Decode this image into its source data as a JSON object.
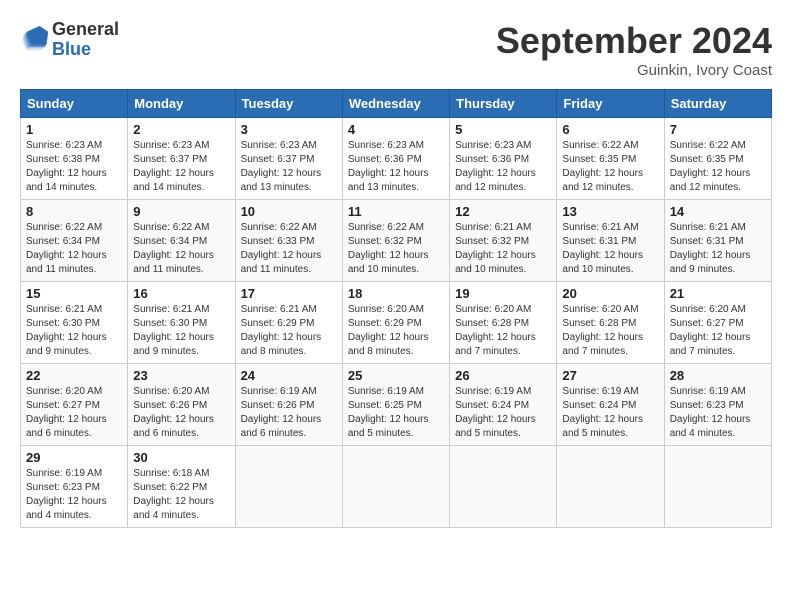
{
  "header": {
    "logo_general": "General",
    "logo_blue": "Blue",
    "month_title": "September 2024",
    "location": "Guinkin, Ivory Coast"
  },
  "days_of_week": [
    "Sunday",
    "Monday",
    "Tuesday",
    "Wednesday",
    "Thursday",
    "Friday",
    "Saturday"
  ],
  "weeks": [
    [
      {
        "num": "1",
        "sunrise": "6:23 AM",
        "sunset": "6:38 PM",
        "daylight": "12 hours and 14 minutes."
      },
      {
        "num": "2",
        "sunrise": "6:23 AM",
        "sunset": "6:37 PM",
        "daylight": "12 hours and 14 minutes."
      },
      {
        "num": "3",
        "sunrise": "6:23 AM",
        "sunset": "6:37 PM",
        "daylight": "12 hours and 13 minutes."
      },
      {
        "num": "4",
        "sunrise": "6:23 AM",
        "sunset": "6:36 PM",
        "daylight": "12 hours and 13 minutes."
      },
      {
        "num": "5",
        "sunrise": "6:23 AM",
        "sunset": "6:36 PM",
        "daylight": "12 hours and 12 minutes."
      },
      {
        "num": "6",
        "sunrise": "6:22 AM",
        "sunset": "6:35 PM",
        "daylight": "12 hours and 12 minutes."
      },
      {
        "num": "7",
        "sunrise": "6:22 AM",
        "sunset": "6:35 PM",
        "daylight": "12 hours and 12 minutes."
      }
    ],
    [
      {
        "num": "8",
        "sunrise": "6:22 AM",
        "sunset": "6:34 PM",
        "daylight": "12 hours and 11 minutes."
      },
      {
        "num": "9",
        "sunrise": "6:22 AM",
        "sunset": "6:34 PM",
        "daylight": "12 hours and 11 minutes."
      },
      {
        "num": "10",
        "sunrise": "6:22 AM",
        "sunset": "6:33 PM",
        "daylight": "12 hours and 11 minutes."
      },
      {
        "num": "11",
        "sunrise": "6:22 AM",
        "sunset": "6:32 PM",
        "daylight": "12 hours and 10 minutes."
      },
      {
        "num": "12",
        "sunrise": "6:21 AM",
        "sunset": "6:32 PM",
        "daylight": "12 hours and 10 minutes."
      },
      {
        "num": "13",
        "sunrise": "6:21 AM",
        "sunset": "6:31 PM",
        "daylight": "12 hours and 10 minutes."
      },
      {
        "num": "14",
        "sunrise": "6:21 AM",
        "sunset": "6:31 PM",
        "daylight": "12 hours and 9 minutes."
      }
    ],
    [
      {
        "num": "15",
        "sunrise": "6:21 AM",
        "sunset": "6:30 PM",
        "daylight": "12 hours and 9 minutes."
      },
      {
        "num": "16",
        "sunrise": "6:21 AM",
        "sunset": "6:30 PM",
        "daylight": "12 hours and 9 minutes."
      },
      {
        "num": "17",
        "sunrise": "6:21 AM",
        "sunset": "6:29 PM",
        "daylight": "12 hours and 8 minutes."
      },
      {
        "num": "18",
        "sunrise": "6:20 AM",
        "sunset": "6:29 PM",
        "daylight": "12 hours and 8 minutes."
      },
      {
        "num": "19",
        "sunrise": "6:20 AM",
        "sunset": "6:28 PM",
        "daylight": "12 hours and 7 minutes."
      },
      {
        "num": "20",
        "sunrise": "6:20 AM",
        "sunset": "6:28 PM",
        "daylight": "12 hours and 7 minutes."
      },
      {
        "num": "21",
        "sunrise": "6:20 AM",
        "sunset": "6:27 PM",
        "daylight": "12 hours and 7 minutes."
      }
    ],
    [
      {
        "num": "22",
        "sunrise": "6:20 AM",
        "sunset": "6:27 PM",
        "daylight": "12 hours and 6 minutes."
      },
      {
        "num": "23",
        "sunrise": "6:20 AM",
        "sunset": "6:26 PM",
        "daylight": "12 hours and 6 minutes."
      },
      {
        "num": "24",
        "sunrise": "6:19 AM",
        "sunset": "6:26 PM",
        "daylight": "12 hours and 6 minutes."
      },
      {
        "num": "25",
        "sunrise": "6:19 AM",
        "sunset": "6:25 PM",
        "daylight": "12 hours and 5 minutes."
      },
      {
        "num": "26",
        "sunrise": "6:19 AM",
        "sunset": "6:24 PM",
        "daylight": "12 hours and 5 minutes."
      },
      {
        "num": "27",
        "sunrise": "6:19 AM",
        "sunset": "6:24 PM",
        "daylight": "12 hours and 5 minutes."
      },
      {
        "num": "28",
        "sunrise": "6:19 AM",
        "sunset": "6:23 PM",
        "daylight": "12 hours and 4 minutes."
      }
    ],
    [
      {
        "num": "29",
        "sunrise": "6:19 AM",
        "sunset": "6:23 PM",
        "daylight": "12 hours and 4 minutes."
      },
      {
        "num": "30",
        "sunrise": "6:18 AM",
        "sunset": "6:22 PM",
        "daylight": "12 hours and 4 minutes."
      },
      null,
      null,
      null,
      null,
      null
    ]
  ],
  "labels": {
    "sunrise": "Sunrise:",
    "sunset": "Sunset:",
    "daylight": "Daylight:"
  }
}
